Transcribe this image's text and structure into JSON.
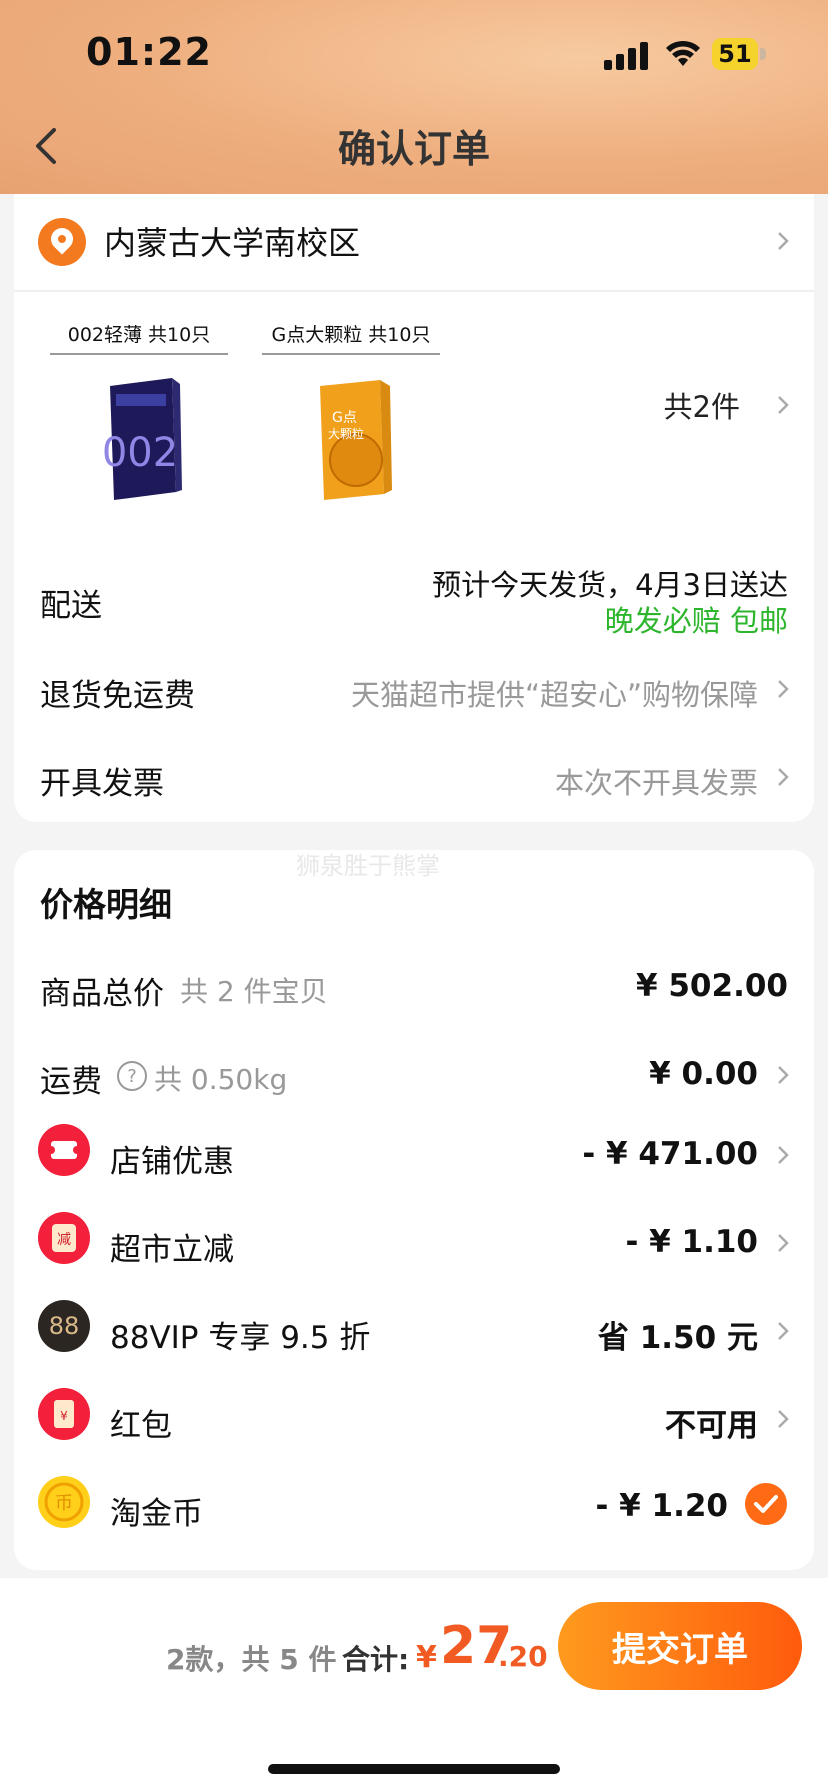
{
  "status": {
    "time": "01:22",
    "battery": "51"
  },
  "header": {
    "title": "确认订单"
  },
  "address": {
    "text": "内蒙古大学南校区"
  },
  "products": [
    {
      "label": "002轻薄 共10只",
      "box_text": "002"
    },
    {
      "label": "G点大颗粒 共10只",
      "box_text": "G点\n大颗粒"
    }
  ],
  "items_total": "共2件",
  "delivery": {
    "label": "配送",
    "estimate": "预计今天发货，4月3日送达",
    "guarantee": "晚发必赔 包邮"
  },
  "returns": {
    "label": "退货免运费",
    "value": "天猫超市提供“超安心”购物保障"
  },
  "invoice": {
    "label": "开具发票",
    "value": "本次不开具发票"
  },
  "watermark": "狮泉胜于熊掌",
  "price_detail": {
    "title": "价格明细",
    "goods": {
      "label": "商品总价",
      "sub": "共 2 件宝贝",
      "value": "¥ 502.00"
    },
    "shipping": {
      "label": "运费",
      "sub": "共 0.50kg",
      "value": "¥ 0.00"
    },
    "shop_discount": {
      "label": "店铺优惠",
      "value": "- ¥ 471.00"
    },
    "market_cut": {
      "label": "超市立减",
      "value": "- ¥ 1.10"
    },
    "vip": {
      "label": "88VIP 专享 9.5 折",
      "value": "省 1.50 元",
      "badge": "88"
    },
    "redpacket": {
      "label": "红包",
      "value": "不可用"
    },
    "coins": {
      "label": "淘金币",
      "value": "- ¥ 1.20"
    }
  },
  "footer": {
    "count": "2款，共 5 件",
    "total_label": "合计:",
    "currency": "¥",
    "total_int": "27",
    "total_dec": ".20",
    "submit": "提交订单"
  },
  "colors": {
    "accent": "#ff5b0c",
    "discount": "#f15a22",
    "green": "#2db62d"
  }
}
